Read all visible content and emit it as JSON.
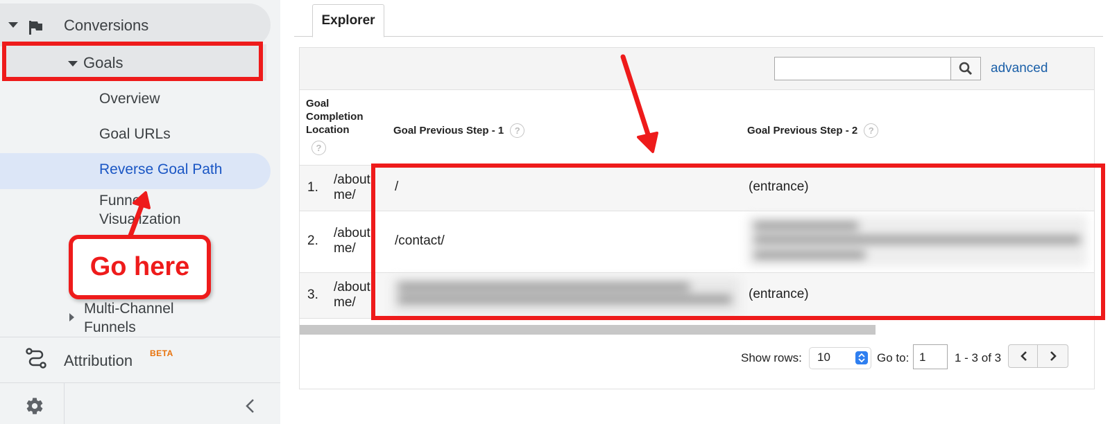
{
  "sidebar": {
    "conversions_label": "Conversions",
    "goals_label": "Goals",
    "items": [
      {
        "label": "Overview"
      },
      {
        "label": "Goal URLs"
      },
      {
        "label": "Reverse Goal Path"
      },
      {
        "label": "Funnel\nVisualization"
      }
    ],
    "multi_channel_label": "Multi-Channel\nFunnels",
    "attribution_label": "Attribution",
    "attribution_badge": "BETA"
  },
  "tabs": [
    {
      "label": "Explorer"
    }
  ],
  "toolbar": {
    "search_value": "",
    "advanced_label": "advanced"
  },
  "table": {
    "columns": [
      {
        "label": "Goal Completion Location"
      },
      {
        "label": "Goal Previous Step - 1"
      },
      {
        "label": "Goal Previous Step - 2"
      }
    ],
    "rows": [
      {
        "index": "1.",
        "location": "/about\nme/",
        "step1": "/",
        "step2": "(entrance)"
      },
      {
        "index": "2.",
        "location": "/about\nme/",
        "step1": "/contact/",
        "step2": ""
      },
      {
        "index": "3.",
        "location": "/about\nme/",
        "step1": "",
        "step2": "(entrance)"
      }
    ]
  },
  "pagination": {
    "show_rows_label": "Show rows:",
    "rows_value": "10",
    "goto_label": "Go to:",
    "goto_value": "1",
    "range_text": "1 - 3 of 3"
  },
  "annotation": {
    "callout_text": "Go here",
    "color": "#ee1b1b"
  },
  "colors": {
    "active_item": "#1a56c4",
    "link": "#1a5fa8",
    "beta": "#e8710a"
  }
}
